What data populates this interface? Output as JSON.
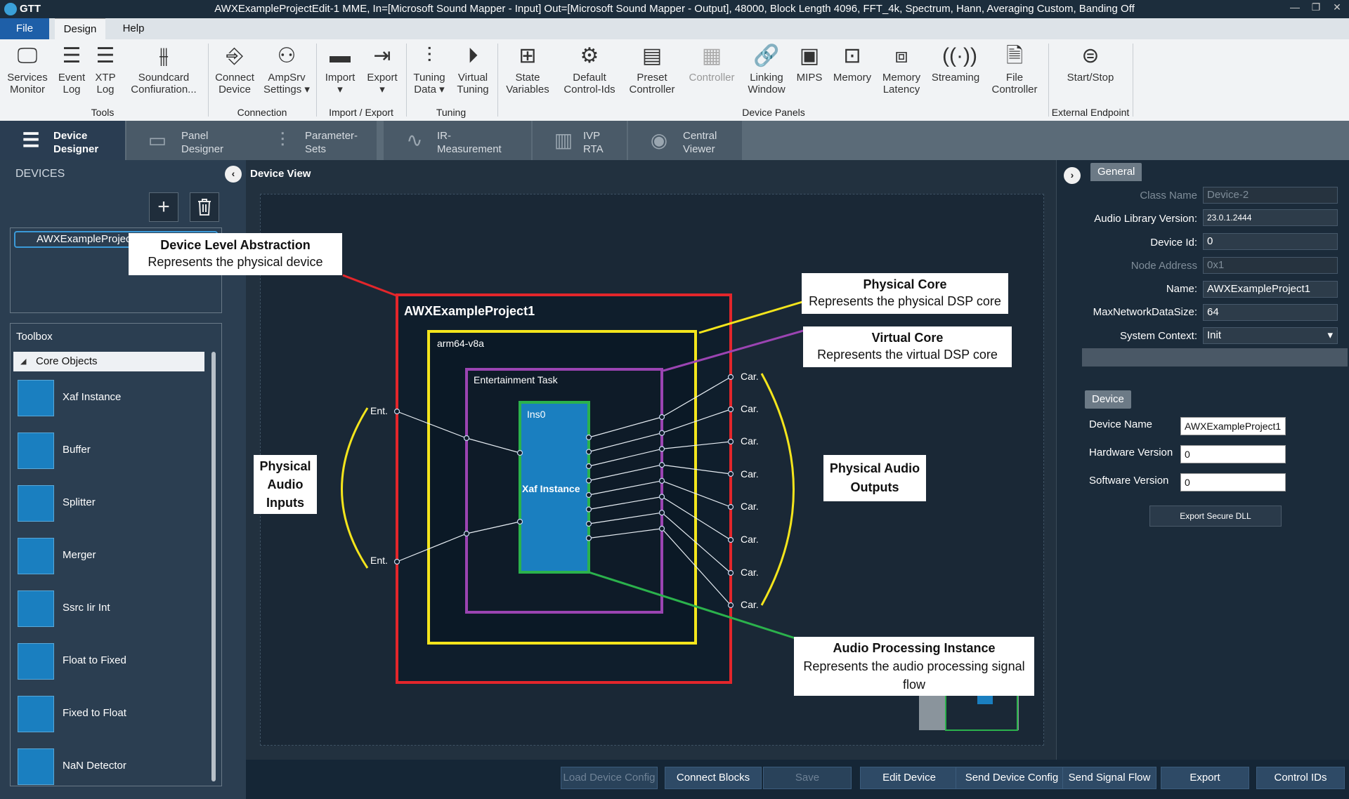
{
  "titlebar": {
    "app_name": "GTT",
    "title": "AWXExampleProjectEdit-1 MME, In=[Microsoft Sound Mapper - Input] Out=[Microsoft Sound Mapper - Output], 48000, Block Length 4096, FFT_4k, Spectrum, Hann, Averaging Custom, Banding Off"
  },
  "menu": {
    "file": "File",
    "design": "Design",
    "help": "Help"
  },
  "ribbon": {
    "tools": {
      "group": "Tools",
      "items": [
        {
          "label1": "Services",
          "label2": "Monitor"
        },
        {
          "label1": "Event",
          "label2": "Log"
        },
        {
          "label1": "XTP",
          "label2": "Log"
        },
        {
          "label1": "Soundcard",
          "label2": "Confiuration..."
        }
      ]
    },
    "connection": {
      "group": "Connection",
      "items": [
        {
          "label1": "Connect",
          "label2": "Device"
        },
        {
          "label1": "AmpSrv",
          "label2": "Settings ▾"
        }
      ]
    },
    "importexport": {
      "group": "Import / Export",
      "items": [
        {
          "label1": "Import",
          "label2": "▾"
        },
        {
          "label1": "Export",
          "label2": "▾"
        }
      ]
    },
    "tuning": {
      "group": "Tuning",
      "items": [
        {
          "label1": "Tuning",
          "label2": "Data ▾"
        },
        {
          "label1": "Virtual",
          "label2": "Tuning"
        }
      ]
    },
    "panels": {
      "group": "Device Panels",
      "items": [
        {
          "label1": "State",
          "label2": "Variables"
        },
        {
          "label1": "Default",
          "label2": "Control-Ids"
        },
        {
          "label1": "Preset",
          "label2": "Controller"
        },
        {
          "label1": "Controller",
          "label2": ""
        },
        {
          "label1": "Linking",
          "label2": "Window"
        },
        {
          "label1": "MIPS",
          "label2": ""
        },
        {
          "label1": "Memory",
          "label2": ""
        },
        {
          "label1": "Memory",
          "label2": "Latency"
        },
        {
          "label1": "Streaming",
          "label2": ""
        },
        {
          "label1": "File",
          "label2": "Controller"
        }
      ]
    },
    "external": {
      "group": "External Endpoint",
      "items": [
        {
          "label1": "Start/Stop",
          "label2": ""
        }
      ]
    }
  },
  "tabs": [
    {
      "l1": "Device",
      "l2": "Designer"
    },
    {
      "l1": "Panel",
      "l2": "Designer"
    },
    {
      "l1": "Parameter-",
      "l2": "Sets"
    },
    {
      "l1": "IR-",
      "l2": "Measurement"
    },
    {
      "l1": "IVP",
      "l2": "RTA"
    },
    {
      "l1": "Central",
      "l2": "Viewer"
    }
  ],
  "left": {
    "devices_label": "DEVICES",
    "add_icon": "+",
    "device_item": "AWXExampleProject1",
    "toolbox_title": "Toolbox",
    "core_objects": "Core Objects",
    "items": [
      "Xaf Instance",
      "Buffer",
      "Splitter",
      "Merger",
      "Ssrc Iir Int",
      "Float to Fixed",
      "Fixed to Float",
      "NaN Detector"
    ]
  },
  "center": {
    "device_view": "Device View",
    "device_name": "AWXExampleProject1",
    "core_name": "arm64-v8a",
    "task_name": "Entertainment Task",
    "instance_id": "Ins0",
    "instance_label": "Xaf Instance",
    "input_label": "Ent.",
    "output_label": "Car.",
    "callouts": {
      "device_title": "Device Level Abstraction",
      "device_sub": "Represents the physical device",
      "core_title": "Physical Core",
      "core_sub": "Represents the physical DSP core",
      "vcore_title": "Virtual Core",
      "vcore_sub": "Represents the virtual DSP core",
      "inputs1": "Physical",
      "inputs2": "Audio",
      "inputs3": "Inputs",
      "outputs1": "Physical Audio",
      "outputs2": "Outputs",
      "api_title": "Audio Processing Instance",
      "api_sub1": "Represents the audio processing signal",
      "api_sub2": "flow"
    }
  },
  "bottom": {
    "load": "Load Device Config",
    "connect": "Connect Blocks",
    "save": "Save",
    "edit": "Edit Device",
    "send_config": "Send Device Config",
    "send_flow": "Send Signal Flow",
    "export": "Export",
    "control_ids": "Control IDs"
  },
  "right": {
    "general": "General",
    "class_name_label": "Class Name",
    "class_name": "Device-2",
    "lib_label": "Audio Library Version:",
    "lib": "23.0.1.2444",
    "devid_label": "Device Id:",
    "devid": "0",
    "node_label": "Node Address",
    "node": "0x1",
    "name_label": "Name:",
    "name": "AWXExampleProject1",
    "maxnet_label": "MaxNetworkDataSize:",
    "maxnet": "64",
    "ctx_label": "System Context:",
    "ctx": "Init",
    "device": "Device",
    "devname_label": "Device Name",
    "devname": "AWXExampleProject1",
    "hw_label": "Hardware Version",
    "hw": "0",
    "sw_label": "Software Version",
    "sw": "0",
    "export_dll": "Export Secure DLL"
  }
}
